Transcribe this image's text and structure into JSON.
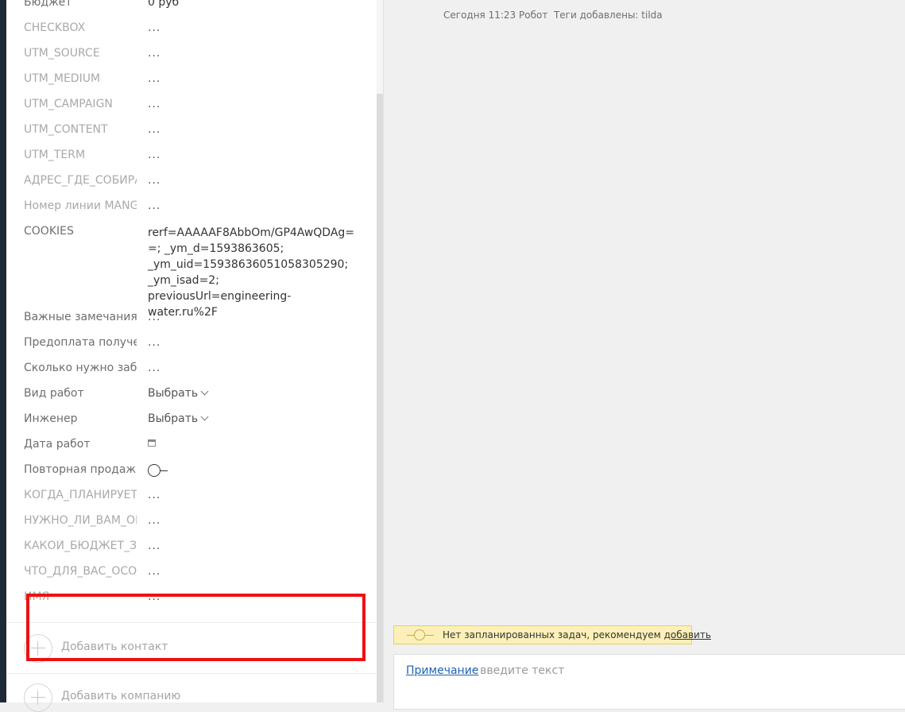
{
  "fields": [
    {
      "label": "Бюджет",
      "value": "0 руб",
      "muted": false
    },
    {
      "label": "CHECKBOX",
      "value": "...",
      "muted": true
    },
    {
      "label": "UTM_SOURCE",
      "value": "...",
      "muted": true
    },
    {
      "label": "UTM_MEDIUM",
      "value": "...",
      "muted": true
    },
    {
      "label": "UTM_CAMPAIGN",
      "value": "...",
      "muted": true
    },
    {
      "label": "UTM_CONTENT",
      "value": "...",
      "muted": true
    },
    {
      "label": "UTM_TERM",
      "value": "...",
      "muted": true
    },
    {
      "label": "АДРЕС_ГДЕ_СОБИРАЕ",
      "value": "...",
      "muted": true
    },
    {
      "label": "Номер линии MANGO",
      "value": "...",
      "muted": true
    }
  ],
  "cookies": {
    "label": "COOKIES",
    "value": "rerf=AAAAAF8AbbOm/GP4AwQDAg==; _ym_d=1593863605; _ym_uid=1593863605105830529​0; _ym_isad=2; previousUrl=engineering-water.ru%2F"
  },
  "fields2": [
    {
      "label": "Важные замечания",
      "value": "..."
    },
    {
      "label": "Предоплата получена",
      "value": "..."
    },
    {
      "label": "Сколько нужно забрат",
      "value": "..."
    }
  ],
  "selects": [
    {
      "label": "Вид работ",
      "value": "Выбрать"
    },
    {
      "label": "Инженер",
      "value": "Выбрать"
    }
  ],
  "date_field": {
    "label": "Дата работ"
  },
  "toggle_field": {
    "label": "Повторная продажа"
  },
  "fields3": [
    {
      "label": "КОГДА_ПЛАНИРУЕТЕ_",
      "value": "..."
    },
    {
      "label": "НУЖНО_ЛИ_ВАМ_ОБУ",
      "value": "..."
    },
    {
      "label": "КАКОЙ_БЮДЖЕТ_ЗАК",
      "value": "..."
    },
    {
      "label": "ЧТО_ДЛЯ_ВАС_ОСОБЕ",
      "value": "..."
    },
    {
      "label": "ИМЯ",
      "value": "..."
    }
  ],
  "add_contact": "Добавить контакт",
  "add_company": "Добавить компанию",
  "feed": {
    "time": "Сегодня 11:23",
    "author": "Робот",
    "text": "Теги добавлены: tilda"
  },
  "tasks": {
    "text": "Нет запланированных задач, рекомендуем",
    "link": "добавить"
  },
  "note": {
    "link": "Примечание",
    "placeholder": ": введите текст"
  }
}
